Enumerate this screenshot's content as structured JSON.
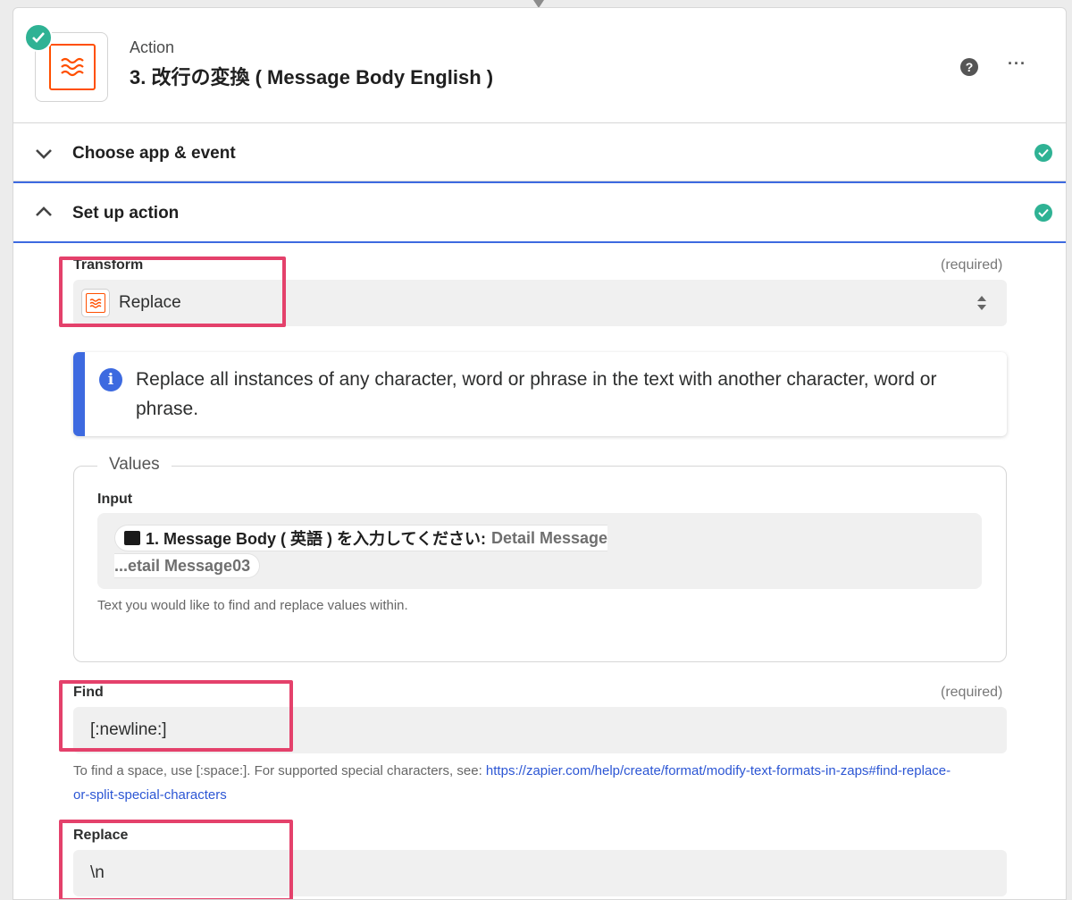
{
  "header": {
    "label": "Action",
    "title": "3. 改行の変換 ( Message Body English )"
  },
  "sections": {
    "choose": {
      "title": "Choose app & event"
    },
    "setup": {
      "title": "Set up action"
    }
  },
  "transform": {
    "label": "Transform",
    "required": "(required)",
    "value": "Replace"
  },
  "info": {
    "text": "Replace all instances of any character, word or phrase in the text with another character, word or phrase."
  },
  "values": {
    "legend": "Values",
    "input_label": "Input",
    "token_step": "1. Message Body ( 英語 ) を入力してください:",
    "token_field_start": "Detail Message",
    "token_field_end": "...etail Message03",
    "help": "Text you would like to find and replace values within."
  },
  "find": {
    "label": "Find",
    "required": "(required)",
    "value": "[:newline:]",
    "help_prefix": "To find a space, use [:space:]. For supported special characters, see: ",
    "help_link": "https://zapier.com/help/create/format/modify-text-formats-in-zaps#find-replace-or-split-special-characters"
  },
  "replace": {
    "label": "Replace",
    "value": "\\n"
  },
  "colors": {
    "accent_orange": "#ff4f00",
    "success_green": "#2fb294",
    "active_blue": "#3d6ae0",
    "highlight_pink": "#e4416b"
  }
}
